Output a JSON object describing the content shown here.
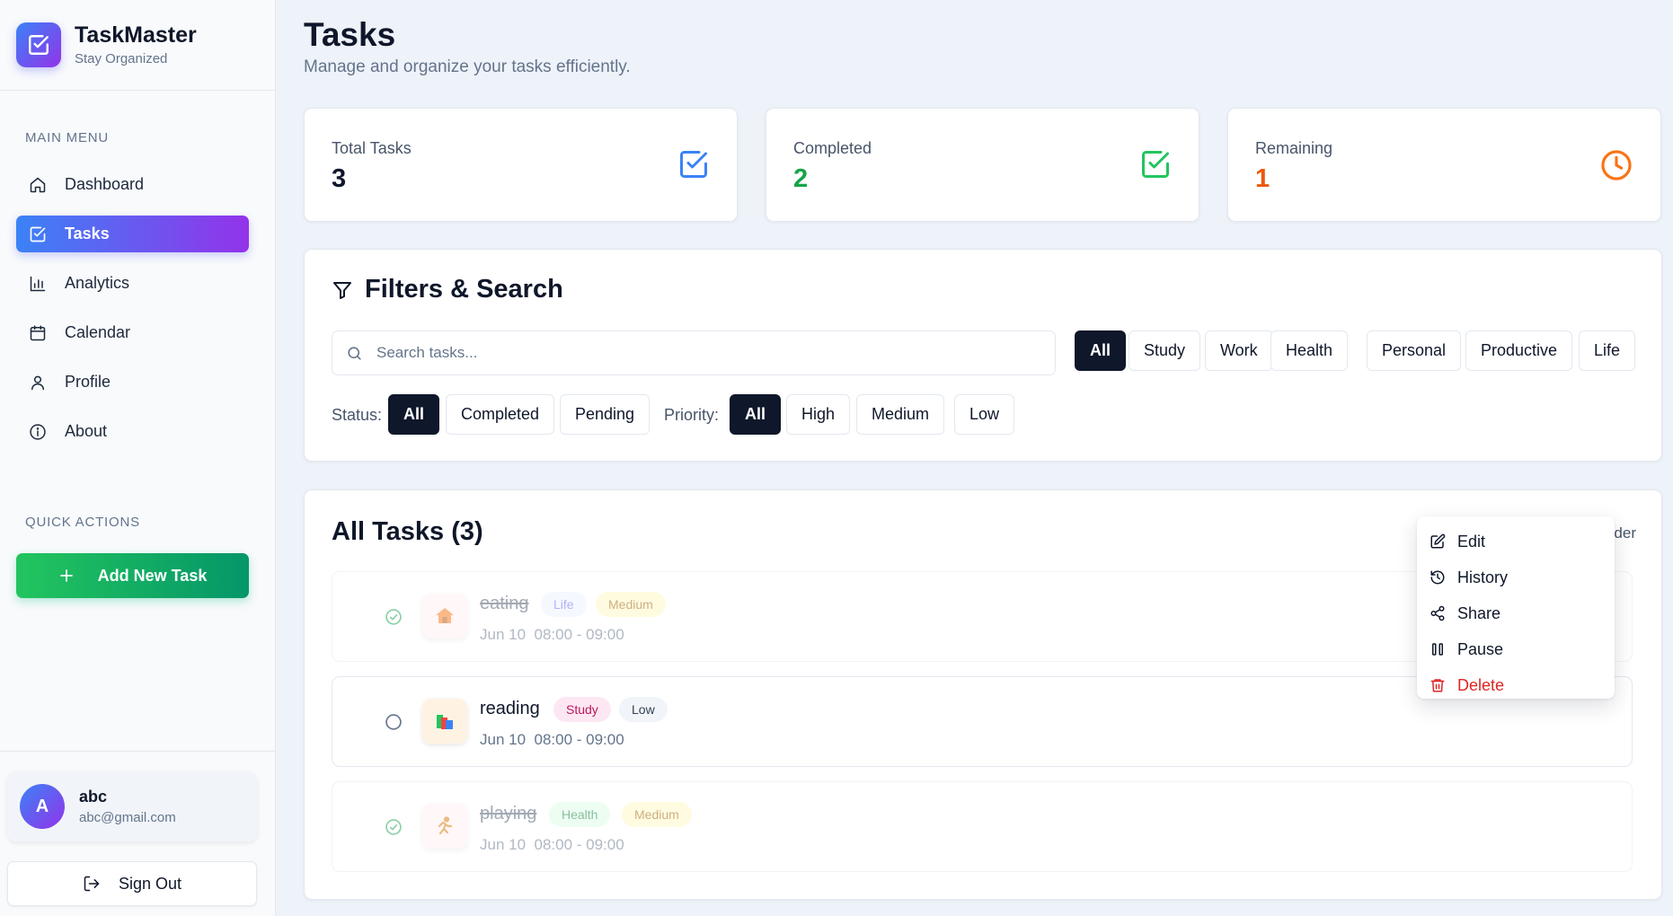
{
  "brand": {
    "name": "TaskMaster",
    "tagline": "Stay Organized",
    "icon": "checkbox-icon"
  },
  "sidebar": {
    "main_menu_label": "MAIN MENU",
    "items": [
      {
        "label": "Dashboard",
        "icon": "home-icon",
        "active": false
      },
      {
        "label": "Tasks",
        "icon": "checkbox-icon",
        "active": true
      },
      {
        "label": "Analytics",
        "icon": "bar-chart-icon",
        "active": false
      },
      {
        "label": "Calendar",
        "icon": "calendar-icon",
        "active": false
      },
      {
        "label": "Profile",
        "icon": "user-icon",
        "active": false
      },
      {
        "label": "About",
        "icon": "info-icon",
        "active": false
      }
    ],
    "quick_actions_label": "QUICK ACTIONS",
    "add_task_label": "Add New Task"
  },
  "user": {
    "initial": "A",
    "name": "abc",
    "email": "abc@gmail.com",
    "sign_out_label": "Sign Out"
  },
  "header": {
    "title": "Tasks",
    "subtitle": "Manage and organize your tasks efficiently."
  },
  "stats": [
    {
      "label": "Total Tasks",
      "value": "3",
      "color": "#0f172a",
      "icon": "checkbox-icon",
      "icon_color": "#3b82f6"
    },
    {
      "label": "Completed",
      "value": "2",
      "color": "#16a34a",
      "icon": "checkbox-icon",
      "icon_color": "#22c55e"
    },
    {
      "label": "Remaining",
      "value": "1",
      "color": "#ea580c",
      "icon": "clock-icon",
      "icon_color": "#f97316"
    }
  ],
  "filters": {
    "title": "Filters & Search",
    "search_placeholder": "Search tasks...",
    "search_value": "",
    "categories": [
      "All",
      "Study",
      "Work",
      "Health",
      "Personal",
      "Productive",
      "Life"
    ],
    "category_selected": "All",
    "status_label": "Status:",
    "statuses": [
      "All",
      "Completed",
      "Pending"
    ],
    "status_selected": "All",
    "priority_label": "Priority:",
    "priorities": [
      "All",
      "High",
      "Medium",
      "Low"
    ],
    "priority_selected": "All"
  },
  "tasks_panel": {
    "title": "All Tasks (3)",
    "sort_text_visible": "der",
    "tasks": [
      {
        "name": "eating",
        "category": "Life",
        "priority": "Medium",
        "date": "Jun 10",
        "time": "08:00 - 09:00",
        "completed": true,
        "icon": "house-emoji"
      },
      {
        "name": "reading",
        "category": "Study",
        "priority": "Low",
        "date": "Jun 10",
        "time": "08:00 - 09:00",
        "completed": false,
        "icon": "books-emoji"
      },
      {
        "name": "playing",
        "category": "Health",
        "priority": "Medium",
        "date": "Jun 10",
        "time": "08:00 - 09:00",
        "completed": true,
        "icon": "running-emoji"
      }
    ]
  },
  "context_menu": {
    "items": [
      {
        "label": "Edit",
        "icon": "edit-icon"
      },
      {
        "label": "History",
        "icon": "history-icon"
      },
      {
        "label": "Share",
        "icon": "share-icon"
      },
      {
        "label": "Pause",
        "icon": "pause-icon"
      },
      {
        "label": "Delete",
        "icon": "trash-icon",
        "danger": true
      }
    ]
  },
  "colors": {
    "accent_gradient": [
      "#3b82f6",
      "#9333ea"
    ],
    "success_gradient": [
      "#22c55e",
      "#059669"
    ],
    "dark_chip": "#0f172a",
    "danger": "#dc2626"
  }
}
